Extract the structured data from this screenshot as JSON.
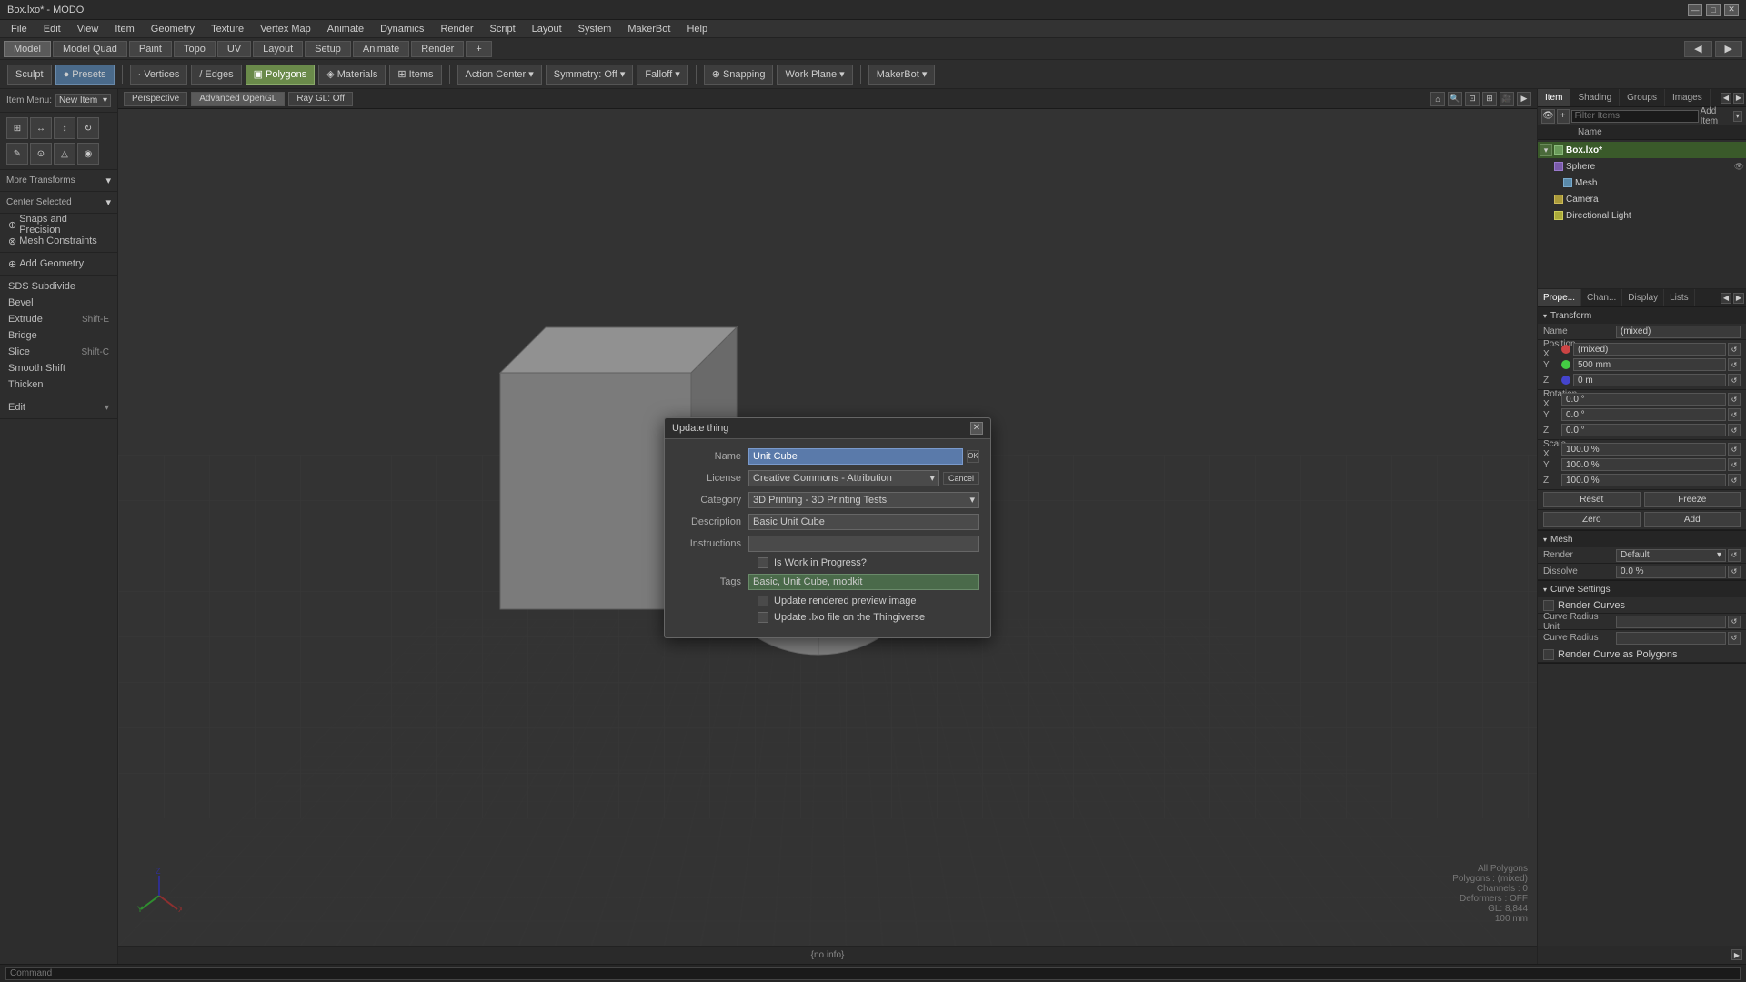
{
  "titleBar": {
    "title": "Box.lxo* - MODO",
    "minimize": "—",
    "maximize": "□",
    "close": "✕"
  },
  "menuBar": {
    "items": [
      "File",
      "Edit",
      "View",
      "Item",
      "Geometry",
      "Texture",
      "Vertex Map",
      "Animate",
      "Dynamics",
      "Render",
      "Script",
      "Layout",
      "System",
      "MakerBot",
      "Help"
    ]
  },
  "modeBar": {
    "modes": [
      "Model",
      "Model Quad",
      "Paint",
      "Topo",
      "UV",
      "Layout",
      "Setup",
      "Animate",
      "Render",
      "+"
    ]
  },
  "toolbar": {
    "sculpt": "Sculpt",
    "presets": "Presets",
    "vertices": "Vertices",
    "edges": "Edges",
    "polygons": "Polygons",
    "materials": "Materials",
    "items": "Items",
    "actionCenter": "Action Center",
    "actionCenterVal": "Action Center ▾",
    "symmetry": "Symmetry: Off ▾",
    "falloff": "Falloff ▾",
    "snapping": "Snapping",
    "workPlane": "Work Plane ▾",
    "makerbot": "MakerBot ▾"
  },
  "viewport": {
    "perspective": "Perspective",
    "renderer": "Advanced OpenGL",
    "raygl": "Ray GL: Off"
  },
  "leftPanel": {
    "itemMenu": "Item Menu: New Item",
    "transforms": "More Transforms",
    "centerSelected": "Center Selected",
    "sections": {
      "snaps": "Snaps and Precision",
      "meshConstraints": "Mesh Constraints",
      "addGeometry": "Add Geometry",
      "sdsSubdivide": "SDS Subdivide",
      "bevel": "Bevel",
      "extrude": "Extrude",
      "bridge": "Bridge",
      "slice": "Slice",
      "smoothShift": "Smooth Shift",
      "thicken": "Thicken",
      "edit": "Edit"
    },
    "shortcuts": {
      "extrude": "Shift-E",
      "slice": "Shift-C"
    }
  },
  "itemPanel": {
    "tabs": [
      "Item",
      "Shading",
      "Groups",
      "Images"
    ],
    "filterPlaceholder": "Filter Items",
    "addItem": "Add Item",
    "columnHeader": "Name",
    "items": [
      {
        "name": "Box.lxo*",
        "level": 0,
        "expanded": true,
        "active": true
      },
      {
        "name": "Sphere",
        "level": 1,
        "active": false
      },
      {
        "name": "Mesh",
        "level": 2,
        "active": false
      },
      {
        "name": "Camera",
        "level": 1,
        "active": false
      },
      {
        "name": "Directional Light",
        "level": 1,
        "active": false
      }
    ]
  },
  "propsPanel": {
    "tabs": [
      "Prope...",
      "Chan...",
      "Display",
      "Lists"
    ],
    "sections": {
      "transform": {
        "title": "Transform",
        "name": {
          "label": "Name",
          "value": "(mixed)"
        },
        "positionX": {
          "label": "Position X",
          "value": "(mixed)",
          "color": "#cc4444"
        },
        "positionY": {
          "label": "Y",
          "value": "500 mm",
          "color": "#44cc44"
        },
        "positionZ": {
          "label": "Z",
          "value": "0 m",
          "color": "#4444cc"
        },
        "rotationX": {
          "label": "Rotation X",
          "value": "0.0 °"
        },
        "rotationY": {
          "label": "Y",
          "value": "0.0 °"
        },
        "rotationZ": {
          "label": "Z",
          "value": "0.0 °"
        },
        "scaleX": {
          "label": "Scale X",
          "value": "100.0 %"
        },
        "scaleY": {
          "label": "Y",
          "value": "100.0 %"
        },
        "scaleZ": {
          "label": "Z",
          "value": "100.0 %"
        },
        "actions": [
          "Reset",
          "Freeze",
          "Zero",
          "Add"
        ]
      },
      "mesh": {
        "title": "Mesh",
        "render": {
          "label": "Render",
          "value": "Default"
        },
        "dissolve": {
          "label": "Dissolve",
          "value": "0.0 %"
        }
      },
      "curveSettings": {
        "title": "Curve Settings",
        "renderCurves": "Render Curves",
        "radiusUnit": {
          "label": "Curve Radius Unit",
          "value": ""
        },
        "radius": {
          "label": "Curve Radius",
          "value": ""
        },
        "renderAsPoly": "Render Curve as Polygons"
      }
    }
  },
  "dialog": {
    "title": "Update thing",
    "nameLabel": "Name",
    "nameValue": "Unit Cube",
    "licenseLabel": "License",
    "licenseValue": "Creative Commons - Attribution",
    "categoryLabel": "Category",
    "categoryValue": "3D Printing - 3D Printing Tests",
    "descriptionLabel": "Description",
    "descriptionValue": "Basic Unit Cube",
    "instructionsLabel": "Instructions",
    "instructionsValue": "",
    "isWipLabel": "Is Work in Progress?",
    "tagsLabel": "Tags",
    "tagsValue": "Basic, Unit Cube, modkit",
    "updatePreviewLabel": "Update rendered preview image",
    "updateFileLabel": "Update .lxo file on the Thingiverse",
    "okLabel": "OK",
    "cancelLabel": "Cancel"
  },
  "statusBar": {
    "message": "{no info}"
  },
  "viewportStats": {
    "mode": "All Polygons",
    "polygons": "Polygons : (mixed)",
    "channels": "Channels : 0",
    "deformers": "Deformers : OFF",
    "gl": "GL: 8,844",
    "scale": "100 mm"
  },
  "rightSidebar": {
    "expandLabel": "▶"
  },
  "commandBar": {
    "placeholder": "Command"
  }
}
